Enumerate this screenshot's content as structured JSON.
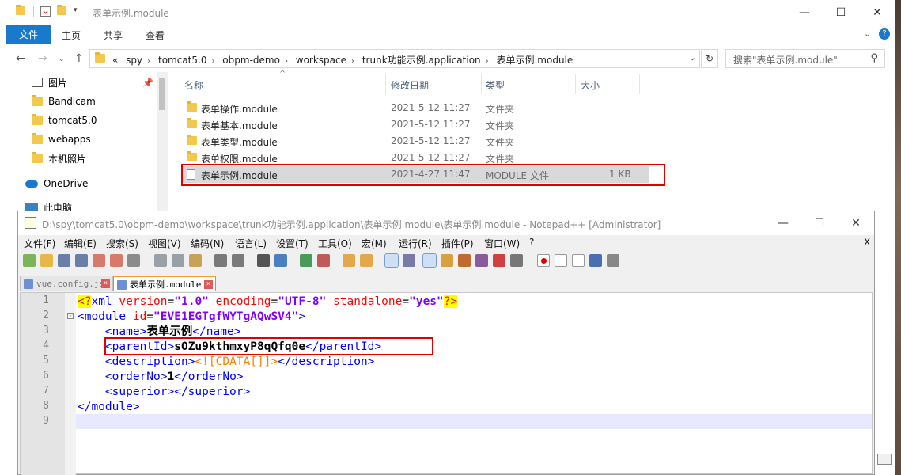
{
  "explorer": {
    "title": "表单示例.module",
    "ribbon_tabs": [
      "文件",
      "主页",
      "共享",
      "查看"
    ],
    "address_crumbs": [
      "spy",
      "tomcat5.0",
      "obpm-demo",
      "workspace",
      "trunk功能示例.application",
      "表单示例.module"
    ],
    "address_prefix": "«",
    "search_placeholder": "搜索\"表单示例.module\"",
    "sidebar_items": [
      "图片",
      "Bandicam",
      "tomcat5.0",
      "webapps",
      "本机照片",
      "OneDrive",
      "此电脑"
    ],
    "columns": [
      "名称",
      "修改日期",
      "类型",
      "大小"
    ],
    "files": [
      {
        "name": "表单操作.module",
        "date": "2021-5-12 11:27",
        "type": "文件夹",
        "size": ""
      },
      {
        "name": "表单基本.module",
        "date": "2021-5-12 11:27",
        "type": "文件夹",
        "size": ""
      },
      {
        "name": "表单类型.module",
        "date": "2021-5-12 11:27",
        "type": "文件夹",
        "size": ""
      },
      {
        "name": "表单权限.module",
        "date": "2021-5-12 11:27",
        "type": "文件夹",
        "size": ""
      },
      {
        "name": "表单示例.module",
        "date": "2021-4-27 11:47",
        "type": "MODULE 文件",
        "size": "1 KB"
      }
    ]
  },
  "npp": {
    "title": "D:\\spy\\tomcat5.0\\obpm-demo\\workspace\\trunk功能示例.application\\表单示例.module\\表单示例.module - Notepad++ [Administrator]",
    "menu": [
      "文件(F)",
      "编辑(E)",
      "搜索(S)",
      "视图(V)",
      "编码(N)",
      "语言(L)",
      "设置(T)",
      "工具(O)",
      "宏(M)",
      "运行(R)",
      "插件(P)",
      "窗口(W)",
      "?"
    ],
    "menu_close": "X",
    "tabs": [
      "vue.config.js",
      "表单示例.module"
    ],
    "line_numbers": [
      "1",
      "2",
      "3",
      "4",
      "5",
      "6",
      "7",
      "8",
      "9"
    ],
    "xml": {
      "decl_open": "<?",
      "decl_name": "xml",
      "version_attr": "version",
      "version_val": "\"1.0\"",
      "encoding_attr": "encoding",
      "encoding_val": "\"UTF-8\"",
      "standalone_attr": "standalone",
      "standalone_val": "\"yes\"",
      "decl_close": "?>",
      "module_open": "<module",
      "id_attr": "id",
      "id_val": "\"EVE1EGTgfWYTgAQwSV4\"",
      "gt": ">",
      "name_open": "<name>",
      "name_text": "表单示例",
      "name_close": "</name>",
      "parent_open": "<parentId>",
      "parent_text": "sOZu9kthmxyP8qQfq0e",
      "parent_close": "</parentId>",
      "desc_open": "<description>",
      "desc_cdata": "<![CDATA[]]>",
      "desc_close": "</description>",
      "order_open": "<orderNo>",
      "order_text": "1",
      "order_close": "</orderNo>",
      "superior": "<superior></superior>",
      "module_close": "</module>"
    }
  },
  "colors": {
    "accent": "#1979ca",
    "highlight_box": "#e00000"
  }
}
